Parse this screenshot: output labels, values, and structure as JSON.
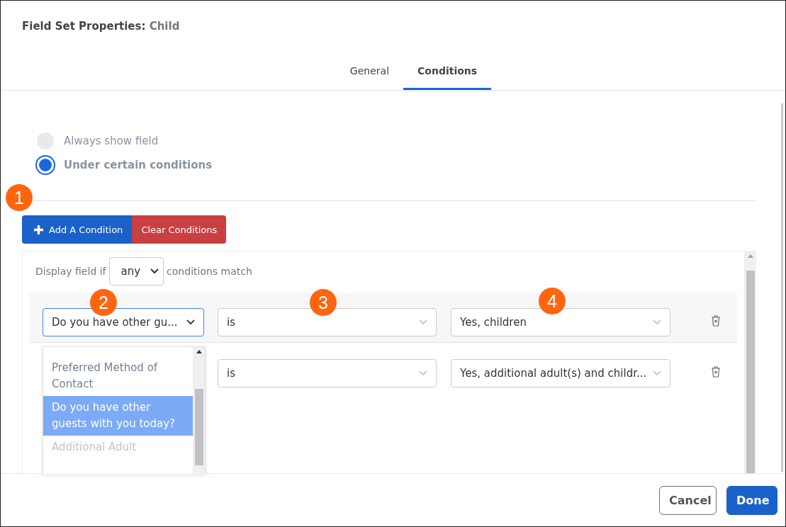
{
  "dialog": {
    "title_label": "Field Set Properties:",
    "title_value": "Child"
  },
  "tabs": [
    {
      "label": "General",
      "selected": false
    },
    {
      "label": "Conditions",
      "selected": true
    }
  ],
  "visibility_options": [
    {
      "label": "Always show field",
      "selected": false
    },
    {
      "label": "Under certain conditions",
      "selected": true
    }
  ],
  "condition_buttons": [
    {
      "kind": "add",
      "label": "Add A Condition"
    },
    {
      "kind": "clear",
      "label": "Clear Conditions"
    }
  ],
  "match": {
    "prefix": "Display field if",
    "value": "any",
    "suffix": "conditions match"
  },
  "conditions": [
    {
      "field": "Do you have other gu...",
      "focused": true,
      "operator": "is",
      "value": "Yes, children"
    },
    {
      "operator": "is",
      "value": "Yes, additional adult(s) and childr..."
    }
  ],
  "field_dropdown": {
    "options": [
      {
        "label": "Preferred Method of Contact",
        "selected": false,
        "disabled": false
      },
      {
        "label": "Do you have other guests with you today?",
        "selected": true,
        "disabled": false
      },
      {
        "label": "Additional Adult",
        "selected": false,
        "disabled": true
      }
    ]
  },
  "callouts": [
    "1",
    "2",
    "3",
    "4"
  ],
  "footer_buttons": [
    {
      "kind": "secondary",
      "label": "Cancel"
    },
    {
      "kind": "primary",
      "label": "Done"
    }
  ]
}
